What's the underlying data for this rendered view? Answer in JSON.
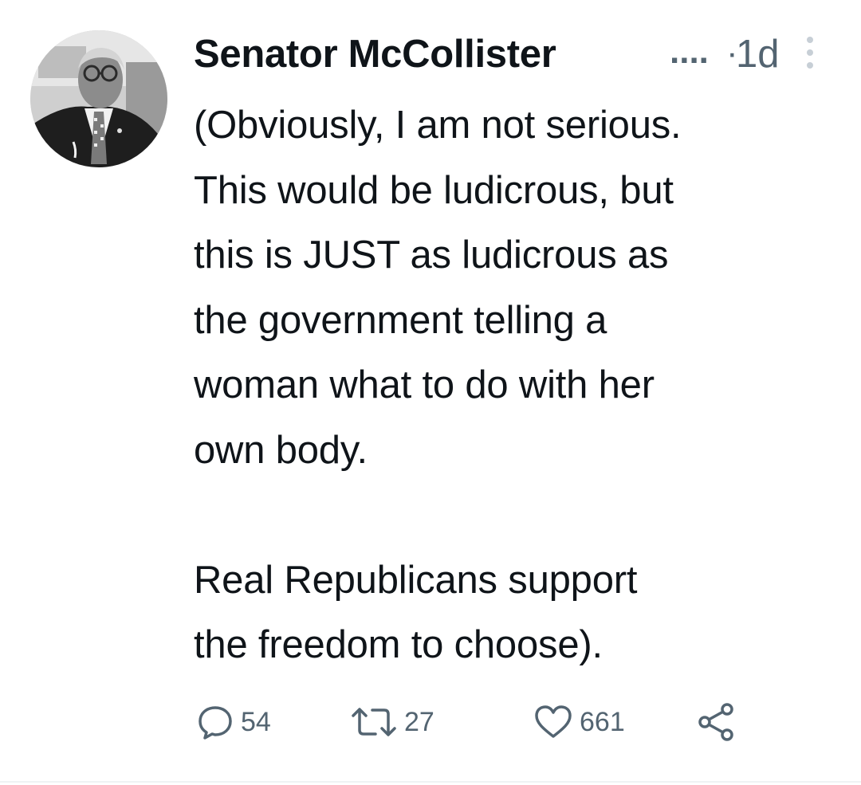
{
  "tweet": {
    "author": {
      "display_name": "Senator McCollister",
      "truncation": "....",
      "avatar_icon": "person-portrait"
    },
    "separator": "·",
    "timestamp": "1d",
    "more_icon": "vertical-ellipsis-icon",
    "text": "(Obviously, I am not serious.\nThis would be ludicrous, but\nthis is JUST as ludicrous as\nthe government telling a\nwoman what to do with her\nown body.\n\nReal Republicans support\nthe freedom to choose).",
    "actions": {
      "replies": "54",
      "retweets": "27",
      "likes": "661"
    },
    "icons": {
      "reply": "speech-bubble-icon",
      "retweet": "retweet-arrows-icon",
      "like": "heart-icon",
      "share": "share-icon"
    },
    "colors": {
      "text": "#0f1419",
      "secondary": "#536471",
      "divider": "#eff3f4"
    }
  }
}
